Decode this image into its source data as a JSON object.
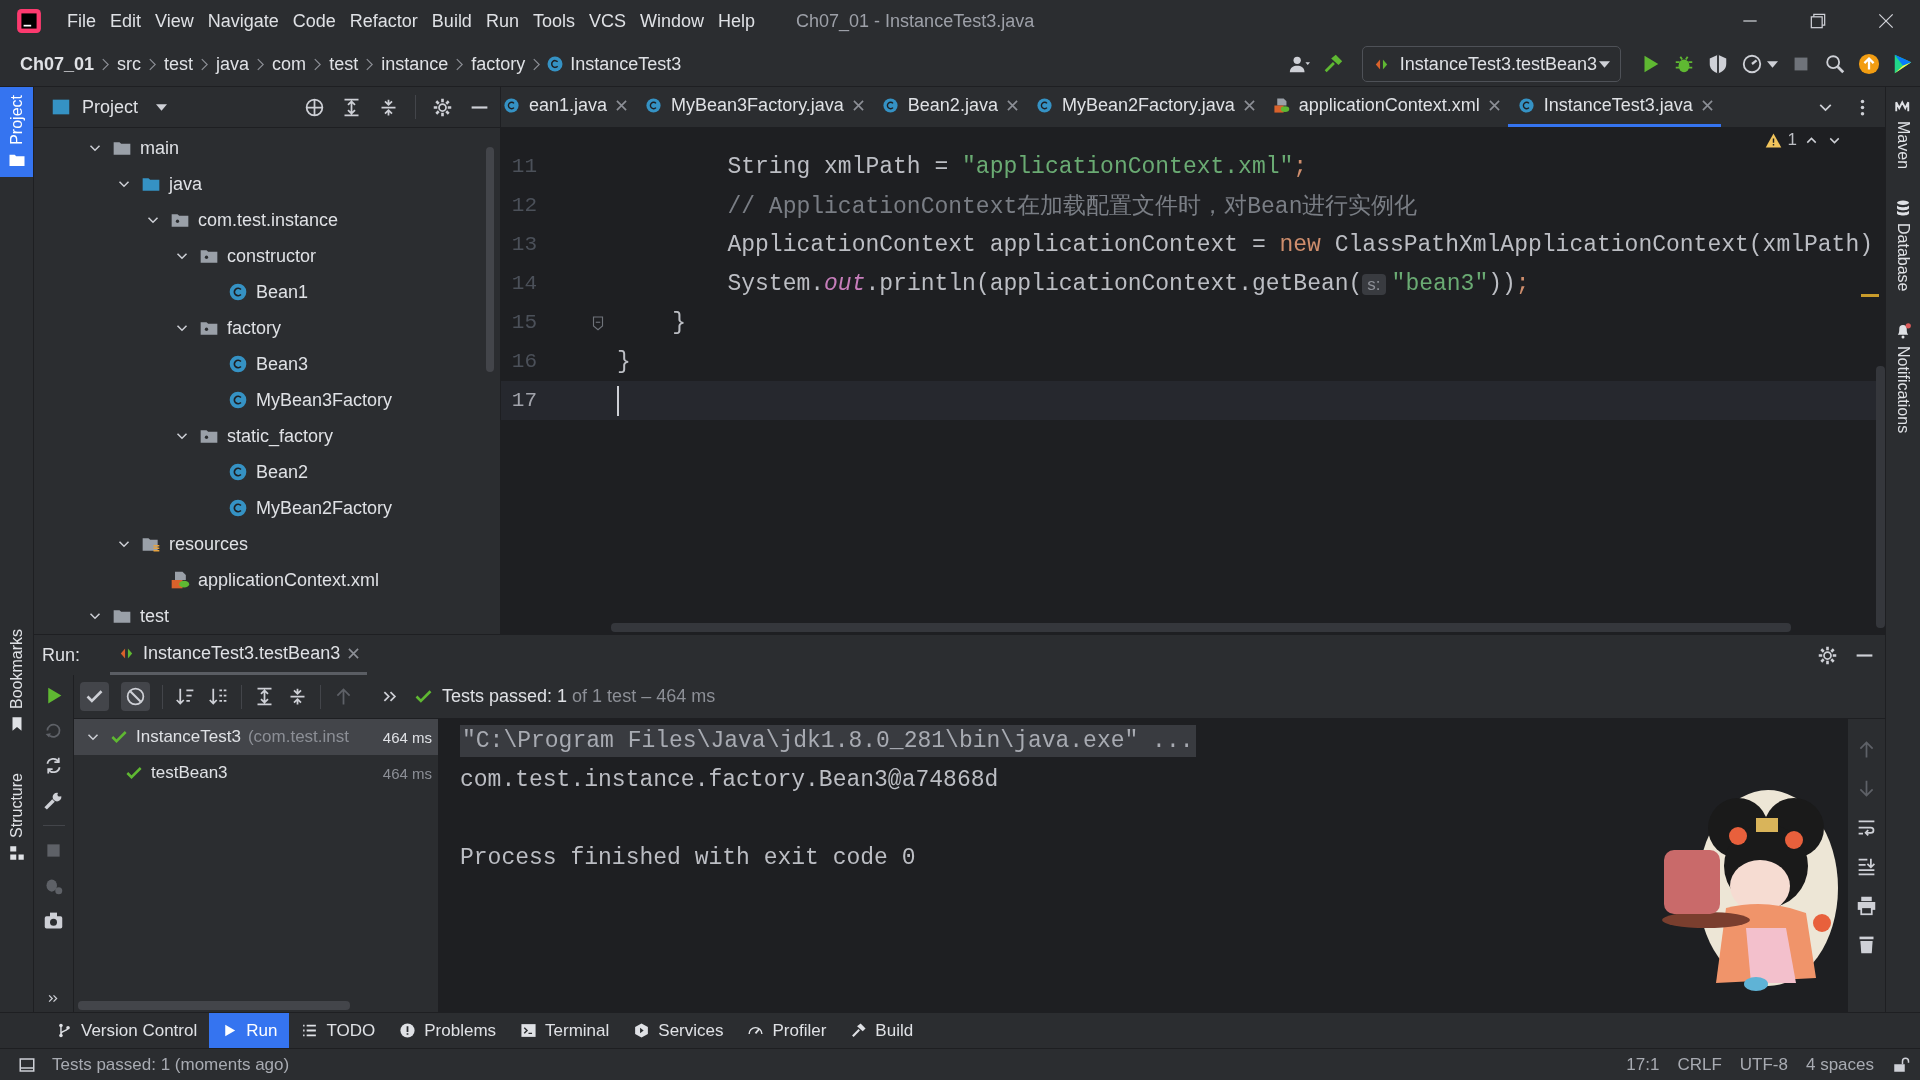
{
  "window": {
    "title": "Ch07_01 - InstanceTest3.java"
  },
  "menu": [
    "File",
    "Edit",
    "View",
    "Navigate",
    "Code",
    "Refactor",
    "Build",
    "Run",
    "Tools",
    "VCS",
    "Window",
    "Help"
  ],
  "breadcrumbs": [
    {
      "label": "Ch07_01",
      "kind": "project"
    },
    {
      "label": "src",
      "kind": "folder"
    },
    {
      "label": "test",
      "kind": "folder"
    },
    {
      "label": "java",
      "kind": "folder"
    },
    {
      "label": "com",
      "kind": "folder"
    },
    {
      "label": "test",
      "kind": "folder"
    },
    {
      "label": "instance",
      "kind": "folder"
    },
    {
      "label": "factory",
      "kind": "folder"
    },
    {
      "label": "InstanceTest3",
      "kind": "class"
    }
  ],
  "run_config": {
    "label": "InstanceTest3.testBean3"
  },
  "left_stripe": {
    "top": [
      {
        "label": "Project",
        "selected": true
      }
    ],
    "bottom": [
      {
        "label": "Bookmarks",
        "selected": false
      },
      {
        "label": "Structure",
        "selected": false
      }
    ]
  },
  "right_stripe": [
    {
      "label": "Maven",
      "kind": "maven"
    },
    {
      "label": "Database",
      "kind": "database"
    },
    {
      "label": "Notifications",
      "kind": "notifications"
    }
  ],
  "project_panel": {
    "title": "Project",
    "tree": [
      {
        "label": "main",
        "kind": "folder",
        "expanded": true,
        "children": [
          {
            "label": "java",
            "kind": "source_root",
            "expanded": true,
            "children": [
              {
                "label": "com.test.instance",
                "kind": "package",
                "expanded": true,
                "children": [
                  {
                    "label": "constructor",
                    "kind": "package",
                    "expanded": true,
                    "children": [
                      {
                        "label": "Bean1",
                        "kind": "class"
                      }
                    ]
                  },
                  {
                    "label": "factory",
                    "kind": "package",
                    "expanded": true,
                    "children": [
                      {
                        "label": "Bean3",
                        "kind": "class"
                      },
                      {
                        "label": "MyBean3Factory",
                        "kind": "class"
                      }
                    ]
                  },
                  {
                    "label": "static_factory",
                    "kind": "package",
                    "expanded": true,
                    "children": [
                      {
                        "label": "Bean2",
                        "kind": "class"
                      },
                      {
                        "label": "MyBean2Factory",
                        "kind": "class"
                      }
                    ]
                  }
                ]
              }
            ]
          },
          {
            "label": "resources",
            "kind": "resources",
            "expanded": true,
            "children": [
              {
                "label": "applicationContext.xml",
                "kind": "xml"
              }
            ]
          }
        ]
      },
      {
        "label": "test",
        "kind": "folder",
        "expanded": true
      }
    ]
  },
  "editor": {
    "tabs": [
      {
        "label": "ean1.java",
        "kind": "class",
        "selected": false
      },
      {
        "label": "MyBean3Factory.java",
        "kind": "class",
        "selected": false
      },
      {
        "label": "Bean2.java",
        "kind": "class",
        "selected": false
      },
      {
        "label": "MyBean2Factory.java",
        "kind": "class",
        "selected": false
      },
      {
        "label": "applicationContext.xml",
        "kind": "xml",
        "selected": false
      },
      {
        "label": "InstanceTest3.java",
        "kind": "class",
        "selected": true
      }
    ],
    "warning_count": "1",
    "lines": [
      {
        "number": "11",
        "current": false,
        "fold": false,
        "tokens": [
          {
            "text": "        String xmlPath = ",
            "kind": "plain"
          },
          {
            "text": "\"applicationContext.xml\"",
            "kind": "string"
          },
          {
            "text": ";",
            "kind": "keyword"
          }
        ]
      },
      {
        "number": "12",
        "current": false,
        "fold": false,
        "tokens": [
          {
            "text": "        // ApplicationContext在加载配置文件时，对Bean进行实例化",
            "kind": "comment"
          }
        ]
      },
      {
        "number": "13",
        "current": false,
        "fold": false,
        "tokens": [
          {
            "text": "        ApplicationContext applicationContext = ",
            "kind": "plain"
          },
          {
            "text": "new",
            "kind": "keyword"
          },
          {
            "text": " ClassPathXmlApplicationContext(xmlPath)",
            "kind": "plain"
          }
        ]
      },
      {
        "number": "14",
        "current": false,
        "fold": false,
        "tokens": [
          {
            "text": "        System.",
            "kind": "plain"
          },
          {
            "text": "out",
            "kind": "field"
          },
          {
            "text": ".println(applicationContext.getBean(",
            "kind": "plain"
          },
          {
            "text": "s:",
            "kind": "hint"
          },
          {
            "text": "\"bean3\"",
            "kind": "string"
          },
          {
            "text": "))",
            "kind": "plain"
          },
          {
            "text": ";",
            "kind": "keyword"
          }
        ]
      },
      {
        "number": "15",
        "current": false,
        "fold": true,
        "tokens": [
          {
            "text": "    }",
            "kind": "plain"
          }
        ]
      },
      {
        "number": "16",
        "current": false,
        "fold": false,
        "tokens": [
          {
            "text": "}",
            "kind": "plain"
          }
        ]
      },
      {
        "number": "17",
        "current": true,
        "fold": false
      }
    ]
  },
  "run_panel": {
    "label": "Run:",
    "tab": "InstanceTest3.testBean3",
    "toggles": [
      {
        "kind": "passed",
        "on": true
      },
      {
        "kind": "ignored",
        "on": true
      }
    ],
    "summary": {
      "passed": "Tests passed: 1",
      "detail": "of 1 test – 464 ms"
    },
    "tests": [
      {
        "name": "InstanceTest3",
        "detail": "(com.test.inst",
        "time": "464 ms",
        "passed": true,
        "selected": true,
        "expanded": true,
        "children": [
          {
            "name": "testBean3",
            "time": "464 ms",
            "passed": true,
            "selected": false
          }
        ]
      }
    ],
    "console": [
      {
        "text": "\"C:\\Program Files\\Java\\jdk1.8.0_281\\bin\\java.exe\" ...",
        "kind": "command"
      },
      {
        "text": "com.test.instance.factory.Bean3@a74868d",
        "kind": "output"
      },
      {
        "kind": "blank"
      },
      {
        "text": "Process finished with exit code 0",
        "kind": "output"
      }
    ]
  },
  "tool_windows": [
    {
      "label": "Version Control",
      "kind": "vcs",
      "selected": false
    },
    {
      "label": "Run",
      "kind": "run",
      "selected": true
    },
    {
      "label": "TODO",
      "kind": "todo",
      "selected": false
    },
    {
      "label": "Problems",
      "kind": "problems",
      "selected": false
    },
    {
      "label": "Terminal",
      "kind": "terminal",
      "selected": false
    },
    {
      "label": "Services",
      "kind": "services",
      "selected": false
    },
    {
      "label": "Profiler",
      "kind": "profiler",
      "selected": false
    },
    {
      "label": "Build",
      "kind": "build",
      "selected": false
    }
  ],
  "status_bar": {
    "message": "Tests passed: 1 (moments ago)",
    "items": [
      "17:1",
      "CRLF",
      "UTF-8",
      "4 spaces"
    ]
  }
}
